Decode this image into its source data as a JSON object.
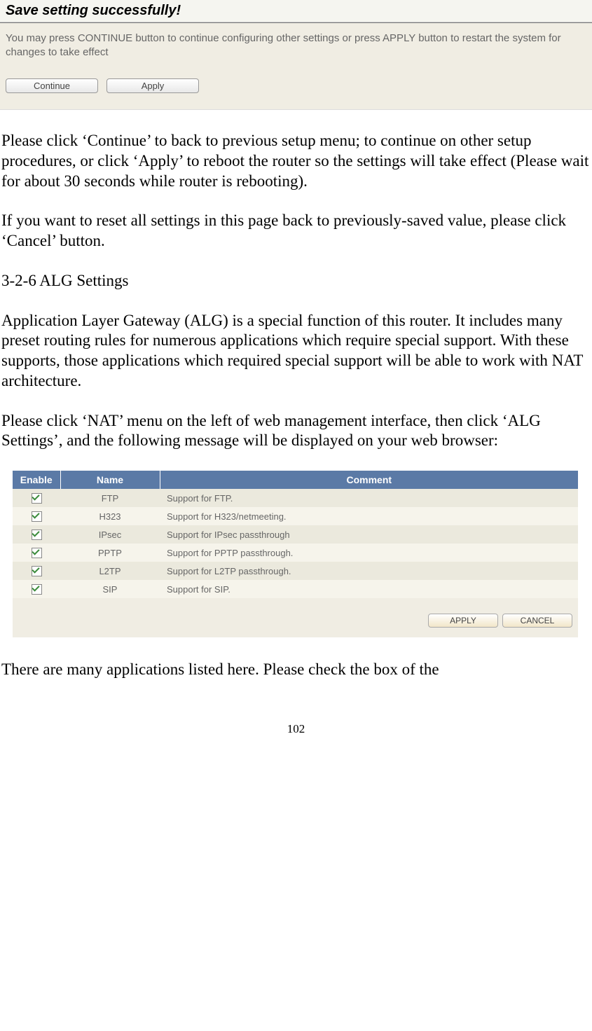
{
  "dialog": {
    "title": "Save setting successfully!",
    "message": "You may press CONTINUE button to continue configuring other settings or press APPLY button to restart the system for changes to take effect",
    "continue_label": "Continue",
    "apply_label": "Apply"
  },
  "body": {
    "p1": "Please click ‘Continue’ to back to previous setup menu; to continue on other setup procedures, or click ‘Apply’ to reboot the router so the settings will take effect (Please wait for about 30 seconds while router is rebooting).",
    "p2": "If you want to reset all settings in this page back to previously-saved value, please click ‘Cancel’ button.",
    "heading": "3-2-6 ALG Settings",
    "p3": "Application Layer Gateway (ALG) is a special function of this router. It includes many preset routing rules for numerous applications which require special support. With these supports, those applications which required special support will be able to work with NAT architecture.",
    "p4": "Please click ‘NAT’ menu on the left of web management interface, then click ‘ALG Settings’, and the following message will be displayed on your web browser:",
    "p5": "There are many applications listed here. Please check the box of the"
  },
  "table": {
    "headers": {
      "enable": "Enable",
      "name": "Name",
      "comment": "Comment"
    },
    "rows": [
      {
        "enabled": true,
        "name": "FTP",
        "comment": "Support for FTP."
      },
      {
        "enabled": true,
        "name": "H323",
        "comment": "Support for H323/netmeeting."
      },
      {
        "enabled": true,
        "name": "IPsec",
        "comment": "Support for IPsec passthrough"
      },
      {
        "enabled": true,
        "name": "PPTP",
        "comment": "Support for PPTP passthrough."
      },
      {
        "enabled": true,
        "name": "L2TP",
        "comment": "Support for L2TP passthrough."
      },
      {
        "enabled": true,
        "name": "SIP",
        "comment": "Support for SIP."
      }
    ],
    "apply_label": "APPLY",
    "cancel_label": "CANCEL"
  },
  "page_number": "102"
}
